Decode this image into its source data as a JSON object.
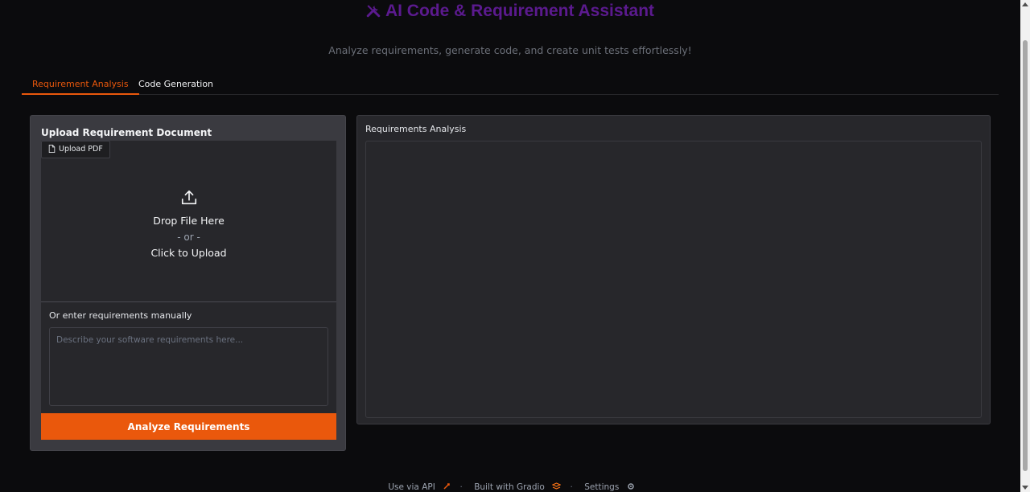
{
  "header": {
    "title": "AI Code & Requirement Assistant",
    "subtitle": "Analyze requirements, generate code, and create unit tests effortlessly!",
    "title_icon": "tools-icon",
    "title_color": "#5b1a8e"
  },
  "tabs": [
    {
      "label": "Requirement Analysis",
      "active": true
    },
    {
      "label": "Code Generation",
      "active": false
    }
  ],
  "left_panel": {
    "upload_label": "Upload Requirement Document",
    "upload_chip": "Upload PDF",
    "drop_text": "Drop File Here",
    "or_text": "- or -",
    "click_text": "Click to Upload",
    "manual_label": "Or enter requirements manually",
    "manual_placeholder": "Describe your software requirements here...",
    "analyze_button": "Analyze Requirements"
  },
  "right_panel": {
    "label": "Requirements Analysis"
  },
  "footer": {
    "api": "Use via API",
    "built": "Built with Gradio",
    "settings": "Settings",
    "separator": "·"
  },
  "colors": {
    "accent": "#ea580c",
    "background": "#0b0b0d",
    "panel": "#27272b"
  }
}
